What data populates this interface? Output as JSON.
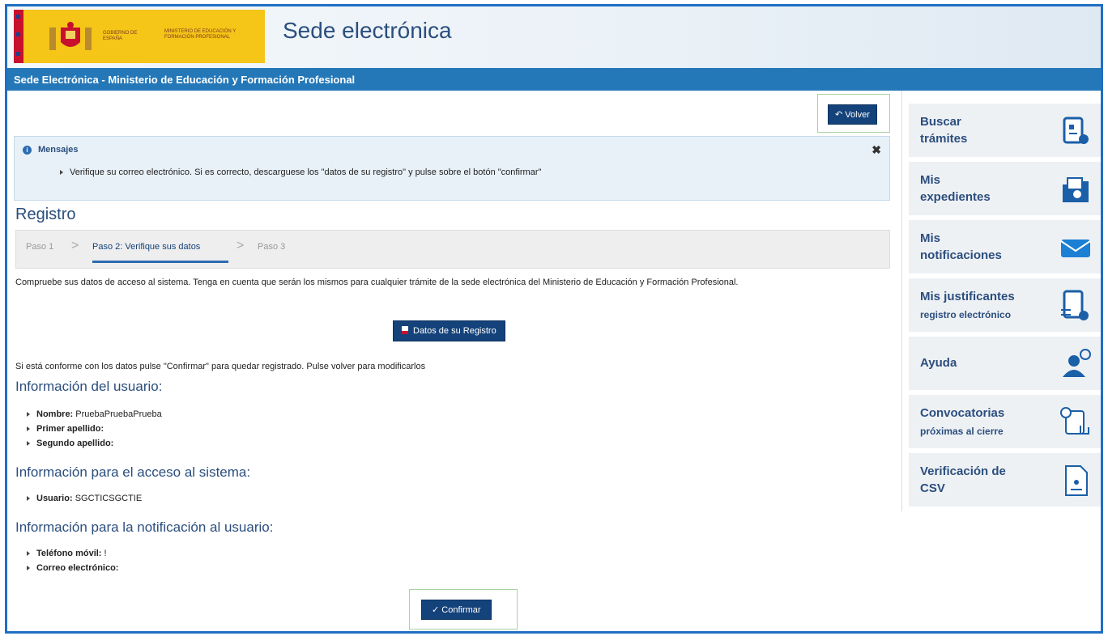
{
  "header": {
    "logo_text_1": "GOBIERNO DE ESPAÑA",
    "logo_text_2": "MINISTERIO DE EDUCACIÓN Y FORMACIÓN PROFESIONAL",
    "site_title": "Sede electrónica",
    "bar_title": "Sede Electrónica - Ministerio de Educación y Formación Profesional"
  },
  "toolbar": {
    "volver_label": "Volver"
  },
  "messages": {
    "title": "Mensajes",
    "close_glyph": "✖",
    "items": [
      "Verifique su correo electrónico. Si es correcto, descarguese los \"datos de su registro\" y pulse sobre el botón \"confirmar\""
    ]
  },
  "registro": {
    "title": "Registro",
    "steps": [
      "Paso 1",
      "Paso 2: Verifique sus datos",
      "Paso 3"
    ],
    "intro": "Compruebe sus datos de acceso al sistema. Tenga en cuenta que serán los mismos para cualquier trámite de la sede electrónica del Ministerio de Educación y Formación Profesional.",
    "datos_button": "Datos de su Registro",
    "confirm_text": "Si está conforme con los datos pulse \"Confirmar\" para quedar registrado. Pulse volver para modificarlos",
    "user_info_title": "Información del usuario:",
    "user_info": [
      {
        "label": "Nombre:",
        "value": "PruebaPruebaPrueba"
      },
      {
        "label": "Primer apellido:",
        "value": ""
      },
      {
        "label": "Segundo apellido:",
        "value": ""
      }
    ],
    "access_title": "Información para el acceso al sistema:",
    "access": [
      {
        "label": "Usuario:",
        "value": "SGCTICSGCTIE"
      }
    ],
    "notif_title": "Información para la notificación al usuario:",
    "notif": [
      {
        "label": "Teléfono móvil:",
        "value": "!"
      },
      {
        "label": "Correo electrónico:",
        "value": ""
      }
    ],
    "confirm_button": "Confirmar"
  },
  "sidebar": {
    "items": [
      {
        "line1": "Buscar",
        "line2": "trámites",
        "sub": "",
        "icon": "search-procedures-icon"
      },
      {
        "line1": "Mis",
        "line2": "expedientes",
        "sub": "",
        "icon": "folder-search-icon"
      },
      {
        "line1": "Mis",
        "line2": "notificaciones",
        "sub": "",
        "icon": "envelope-icon"
      },
      {
        "line1": "Mis justificantes",
        "line2": "",
        "sub": "registro electrónico",
        "icon": "receipt-icon"
      },
      {
        "line1": "Ayuda",
        "line2": "",
        "sub": "",
        "icon": "help-user-icon"
      },
      {
        "line1": "Convocatorias",
        "line2": "",
        "sub": "próximas al cierre",
        "icon": "calendar-hand-icon"
      },
      {
        "line1": "Verificación de",
        "line2": "CSV",
        "sub": "",
        "icon": "csv-document-icon"
      }
    ]
  },
  "colors": {
    "brand_blue": "#2578b8",
    "dark_button": "#14427a",
    "title_blue": "#2b4e7e",
    "frame": "#1f6fc4"
  }
}
